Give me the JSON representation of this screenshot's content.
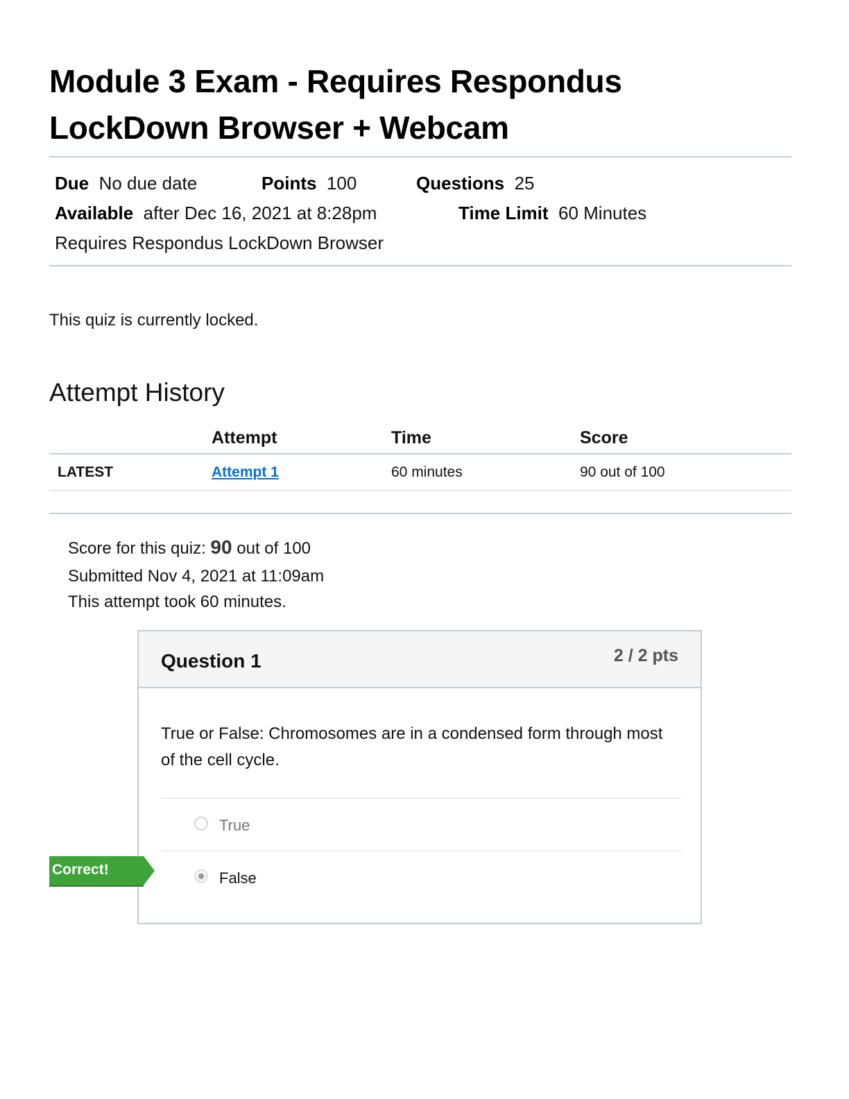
{
  "page": {
    "title_line1": "Module 3 Exam - Requires Respondus",
    "title_line2": "LockDown Browser + Webcam"
  },
  "details": {
    "due_label": "Due",
    "due_value": "No due date",
    "points_label": "Points",
    "points_value": "100",
    "questions_label": "Questions",
    "questions_value": "25",
    "available_label": "Available",
    "available_value": "after Dec 16, 2021 at 8:28pm",
    "time_limit_label": "Time Limit",
    "time_limit_value": "60 Minutes",
    "requirement": "Requires Respondus LockDown Browser"
  },
  "status": {
    "locked_message": "This quiz is currently locked."
  },
  "attempt_history": {
    "heading": "Attempt History",
    "columns": [
      "",
      "Attempt",
      "Time",
      "Score"
    ],
    "rows": [
      {
        "tag": "LATEST",
        "attempt": "Attempt 1",
        "time": "60 minutes",
        "score": "90 out of 100"
      }
    ]
  },
  "result": {
    "score_prefix": "Score for this quiz:",
    "score": "90",
    "score_suffix": "out of 100",
    "submitted": "Submitted Nov 4, 2021 at 11:09am",
    "duration": "This attempt took 60 minutes."
  },
  "question": {
    "title": "Question 1",
    "points": "2 / 2 pts",
    "text": "True or False: Chromosomes are in a condensed form through most of the cell cycle.",
    "answers": [
      {
        "label": "True",
        "selected": false
      },
      {
        "label": "False",
        "selected": true
      }
    ],
    "feedback_label": "Correct!",
    "colors": {
      "correct": "#3ea43a",
      "link": "#0770d6"
    }
  }
}
